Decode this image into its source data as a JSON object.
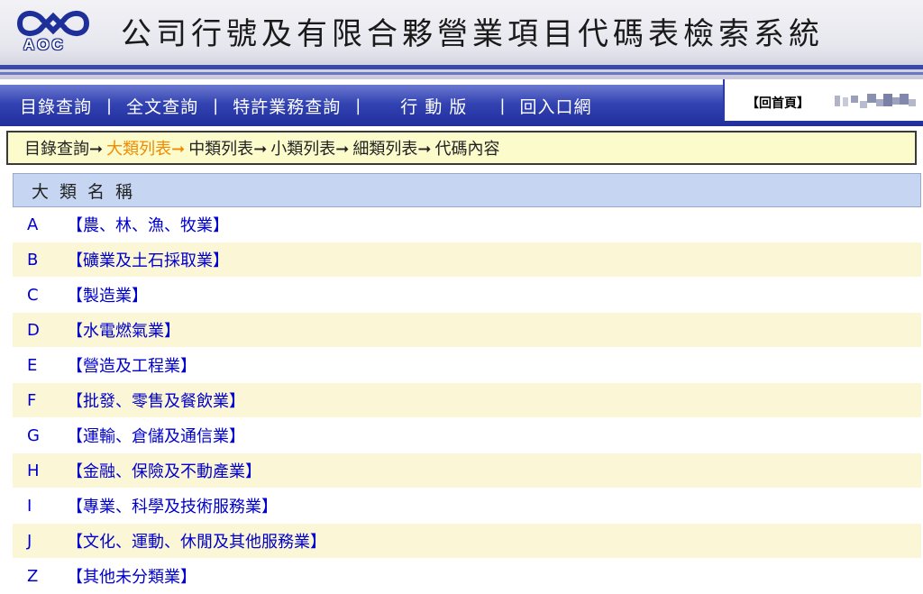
{
  "header": {
    "logo_text": "AOC",
    "title": "公司行號及有限合夥營業項目代碼表檢索系統"
  },
  "nav": {
    "items": [
      {
        "label": "目錄查詢"
      },
      {
        "label": "全文查詢"
      },
      {
        "label": "特許業務查詢"
      },
      {
        "label": "行 動 版"
      },
      {
        "label": "回入口網"
      }
    ],
    "separator": "|",
    "home_label": "【回首頁】"
  },
  "breadcrumb": {
    "items": [
      {
        "label": "目錄查詢",
        "arrow": "➞"
      },
      {
        "label": "大類列表",
        "arrow": "➞"
      },
      {
        "label": "中類列表",
        "arrow": "➞"
      },
      {
        "label": "小類列表",
        "arrow": "➞"
      },
      {
        "label": "細類列表",
        "arrow": "➞"
      },
      {
        "label": "代碼內容",
        "arrow": ""
      }
    ],
    "active_index": 1,
    "active_color": "#f28a00"
  },
  "table": {
    "header": "大類名稱",
    "rows": [
      {
        "code": "A",
        "name": "【農、林、漁、牧業】"
      },
      {
        "code": "B",
        "name": "【礦業及土石採取業】"
      },
      {
        "code": "C",
        "name": "【製造業】"
      },
      {
        "code": "D",
        "name": "【水電燃氣業】"
      },
      {
        "code": "E",
        "name": "【營造及工程業】"
      },
      {
        "code": "F",
        "name": "【批發、零售及餐飲業】"
      },
      {
        "code": "G",
        "name": "【運輸、倉儲及通信業】"
      },
      {
        "code": "H",
        "name": "【金融、保險及不動產業】"
      },
      {
        "code": "I",
        "name": "【專業、科學及技術服務業】"
      },
      {
        "code": "J",
        "name": "【文化、運動、休閒及其他服務業】"
      },
      {
        "code": "Z",
        "name": "【其他未分類業】"
      }
    ]
  },
  "colors": {
    "nav_blue": "#2a3aa6",
    "link_blue": "#0000cc",
    "row_alt": "#fbf6d6",
    "header_row": "#c6d6f2",
    "breadcrumb_bg": "#fbfbcc"
  }
}
